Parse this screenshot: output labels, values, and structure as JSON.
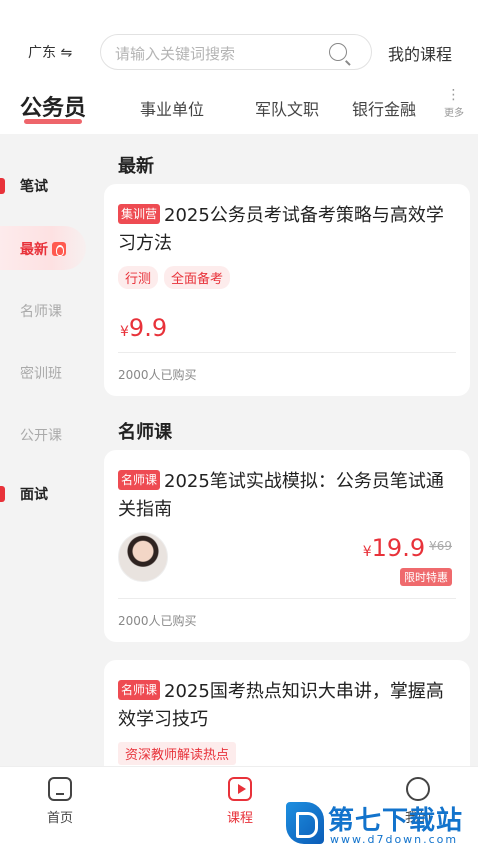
{
  "header": {
    "region": "广东 ⇋",
    "search_placeholder": "请输入关键词搜索",
    "my_courses": "我的课程"
  },
  "categories": {
    "active": "公务员",
    "items": [
      "事业单位",
      "军队文职",
      "银行金融"
    ],
    "more_label": "更多"
  },
  "sidebar": {
    "groups": [
      {
        "label": "笔试",
        "items": [
          "最新",
          "名师课",
          "密训班",
          "公开课"
        ]
      },
      {
        "label": "面试",
        "items": []
      }
    ],
    "active_item": "最新"
  },
  "sections": [
    {
      "title": "最新",
      "cards": [
        {
          "tag": "集训营",
          "title": "2025公务员考试备考策略与高效学习方法",
          "chips": [
            "行测",
            "全面备考"
          ],
          "currency": "¥",
          "price": "9.9",
          "buyers": "2000人已购买"
        }
      ]
    },
    {
      "title": "名师课",
      "cards": [
        {
          "tag": "名师课",
          "title": "2025笔试实战模拟：公务员笔试通关指南",
          "currency": "¥",
          "price": "19.9",
          "original_price": "¥69",
          "promo": "限时特惠",
          "buyers": "2000人已购买"
        },
        {
          "tag": "名师课",
          "title": "2025国考热点知识大串讲，掌握高效学习技巧",
          "chips": [
            "资深教师解读热点"
          ]
        }
      ]
    }
  ],
  "bottom_nav": [
    {
      "label": "首页",
      "icon": "home-icon",
      "active": false
    },
    {
      "label": "课程",
      "icon": "course-play-icon",
      "active": true
    },
    {
      "label": "我的",
      "icon": "profile-smile-icon",
      "active": false
    }
  ],
  "watermark": {
    "brand": "第七下载站",
    "url": "www.d7down.com"
  },
  "colors": {
    "accent": "#e8323a",
    "background": "#f3f3f3",
    "card": "#ffffff"
  }
}
